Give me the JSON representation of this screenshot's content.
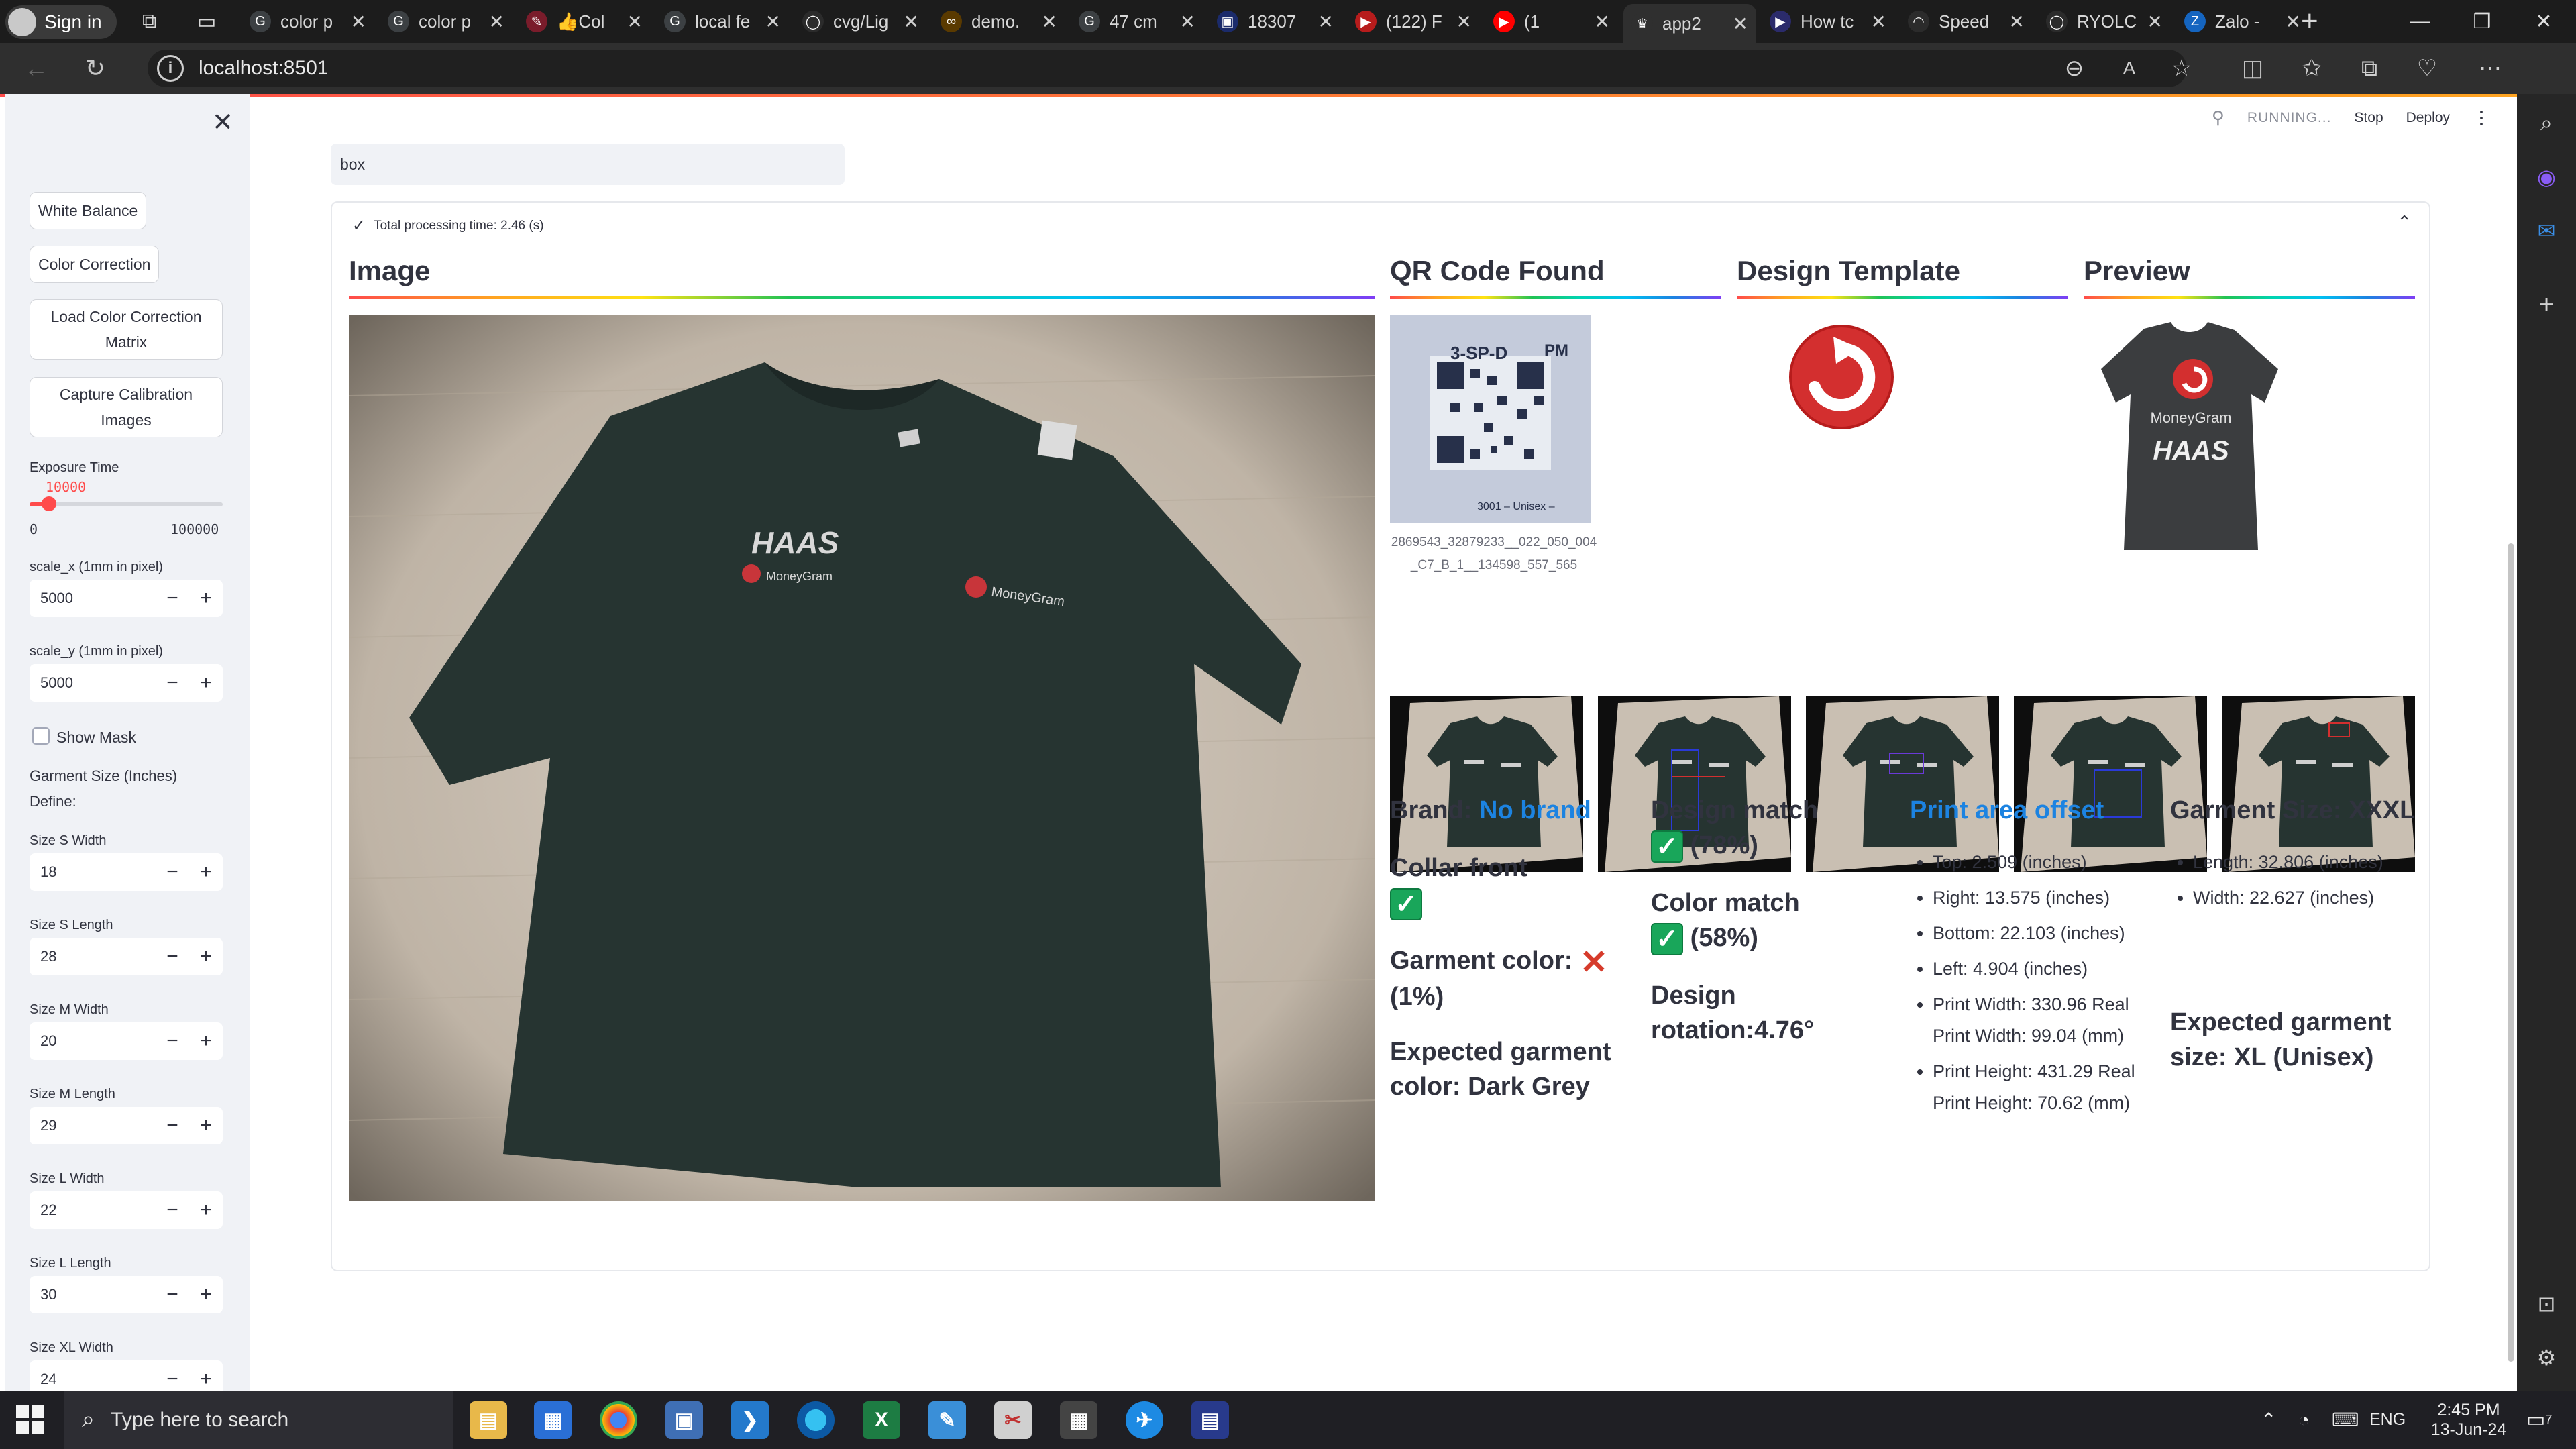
{
  "browser": {
    "profile_label": "Sign in",
    "tabs": [
      {
        "label": "color p",
        "fav": "G",
        "color": "#3c4043"
      },
      {
        "label": "color p",
        "fav": "G",
        "color": "#3c4043"
      },
      {
        "label": "Col",
        "fav": "✎",
        "color": "#7a1c2b",
        "prefix": "👍"
      },
      {
        "label": "local fe",
        "fav": "G",
        "color": "#3c4043"
      },
      {
        "label": "cvg/Lig",
        "fav": "◯",
        "color": "#2b2b2b"
      },
      {
        "label": "demo.",
        "fav": "∞",
        "color": "#5a3a00"
      },
      {
        "label": "47 cm",
        "fav": "G",
        "color": "#3c4043"
      },
      {
        "label": "18307",
        "fav": "▣",
        "color": "#1b2b6b"
      },
      {
        "label": "(122) F",
        "fav": "▶",
        "color": "#b71c1c"
      },
      {
        "label": "(1",
        "fav": "▶",
        "color": "#ff0000"
      },
      {
        "label": "app2",
        "fav": "♛",
        "color": "#2f2f2f",
        "active": true
      },
      {
        "label": "How tc",
        "fav": "▶",
        "color": "#2b2b6b"
      },
      {
        "label": "Speed",
        "fav": "◠",
        "color": "#2b2b2b"
      },
      {
        "label": "RYOLC",
        "fav": "◯",
        "color": "#2b2b2b"
      },
      {
        "label": "Zalo -",
        "fav": "Z",
        "color": "#1565c0"
      }
    ],
    "url": "localhost:8501"
  },
  "sidebar": {
    "buttons": [
      "White Balance",
      "Color Correction",
      "Load Color Correction Matrix",
      "Capture Calibration Images"
    ],
    "exposure": {
      "label": "Exposure Time",
      "value": "10000",
      "min": "0",
      "max": "100000",
      "fraction": 0.1
    },
    "scale_x": {
      "label": "scale_x (1mm in pixel)",
      "value": "5000"
    },
    "scale_y": {
      "label": "scale_y (1mm in pixel)",
      "value": "5000"
    },
    "show_mask": "Show Mask",
    "garment_size_label": "Garment Size (Inches)",
    "define_label": "Define:",
    "sizes": [
      {
        "label": "Size S Width",
        "value": "18"
      },
      {
        "label": "Size S Length",
        "value": "28"
      },
      {
        "label": "Size M Width",
        "value": "20"
      },
      {
        "label": "Size M Length",
        "value": "29"
      },
      {
        "label": "Size L Width",
        "value": "22"
      },
      {
        "label": "Size L Length",
        "value": "30"
      },
      {
        "label": "Size XL Width",
        "value": "24"
      }
    ]
  },
  "header": {
    "running": "RUNNING...",
    "stop": "Stop",
    "deploy": "Deploy",
    "menu": "⋮"
  },
  "main": {
    "search_value": "box",
    "expander_title": "Total processing time: 2.46 (s)",
    "sections": {
      "image": "Image",
      "qr": "QR Code Found",
      "template": "Design Template",
      "preview": "Preview"
    },
    "qr_caption": "2869543_32879233__022_050_004_C7_B_1__134598_557_565",
    "qr_label_text": "3-SP-D",
    "qr_label_pm": "PM",
    "qr_label_bottom": "3001 – Unisex –",
    "tshirt_logo_text": "HAAS",
    "tshirt_brand_text": "MoneyGram",
    "results": {
      "brand_label": "Brand:",
      "brand_value": "No brand",
      "collar_label": "Collar front",
      "garment_color_label": "Garment color:",
      "garment_color_value": "(1%)",
      "expected_color": "Expected garment color: Dark Grey",
      "design_match_label": "Design match",
      "design_match_value": "(78%)",
      "color_match_label": "Color match",
      "color_match_value": "(58%)",
      "design_rotation": "Design rotation:4.76°",
      "print_area_title": "Print area offset",
      "print_area": [
        "Top: 2.509 (inches)",
        "Right: 13.575 (inches)",
        "Bottom: 22.103 (inches)",
        "Left: 4.904 (inches)",
        "Print Width: 330.96 Real Print Width: 99.04 (mm)",
        "Print Height: 431.29 Real Print Height: 70.62 (mm)"
      ],
      "garment_size_title": "Garment Size: XXXL",
      "garment_size": [
        "Length: 32.806 (inches)",
        "Width: 22.627 (inches)"
      ],
      "expected_size": "Expected garment size: XL (Unisex)"
    }
  },
  "taskbar": {
    "search_placeholder": "Type here to search",
    "lang": "ENG",
    "time": "2:45 PM",
    "date": "13-Jun-24",
    "notif": "7"
  }
}
